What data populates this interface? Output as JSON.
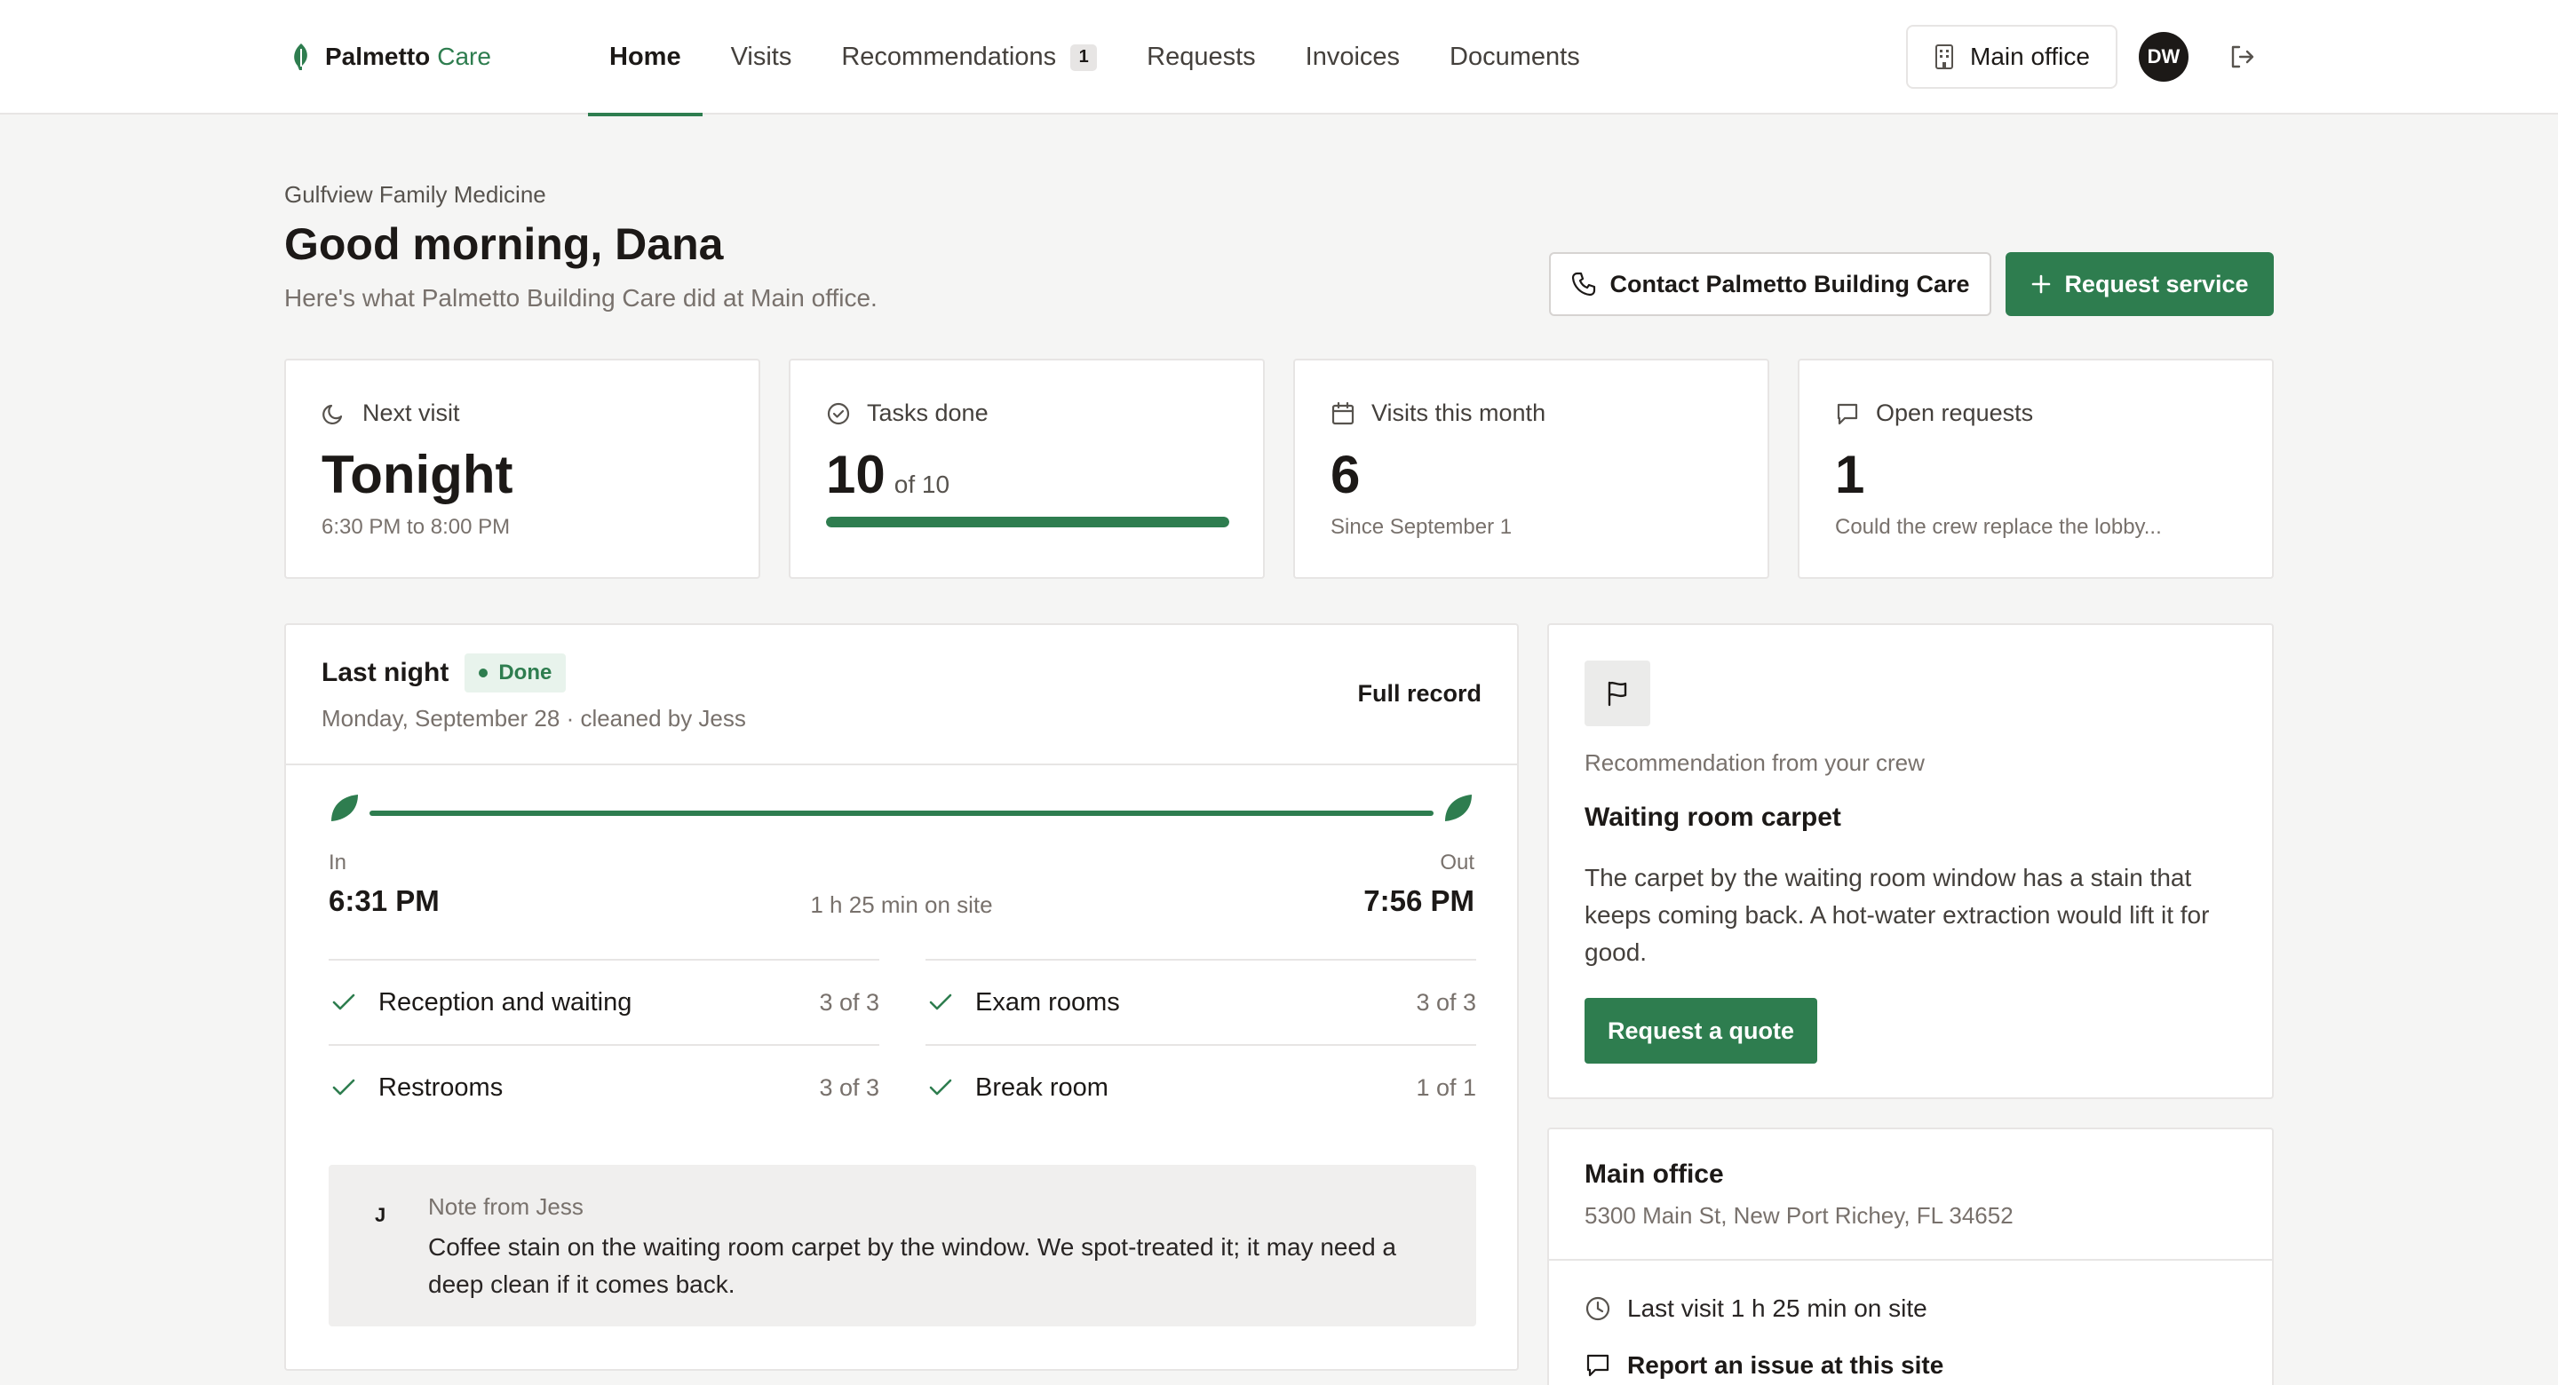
{
  "brand": {
    "name": "Palmetto",
    "suffix": "Care"
  },
  "nav": {
    "tabs": [
      {
        "label": "Home",
        "active": true
      },
      {
        "label": "Visits"
      },
      {
        "label": "Recommendations",
        "badge": "1"
      },
      {
        "label": "Requests"
      },
      {
        "label": "Invoices"
      },
      {
        "label": "Documents"
      }
    ]
  },
  "header": {
    "office_label": "Main office",
    "avatar_initials": "DW"
  },
  "page": {
    "org": "Gulfview Family Medicine",
    "greeting": "Good morning, Dana",
    "subtitle": "Here's what Palmetto Building Care did at Main office.",
    "contact_label": "Contact Palmetto Building Care",
    "request_label": "Request service"
  },
  "stats": {
    "next_visit": {
      "label": "Next visit",
      "value": "Tonight",
      "sub": "6:30 PM to 8:00 PM"
    },
    "tasks_done": {
      "label": "Tasks done",
      "value": "10",
      "of": "of 10",
      "progress": 1.0
    },
    "visits_month": {
      "label": "Visits this month",
      "value": "6",
      "sub": "Since September 1"
    },
    "open_requests": {
      "label": "Open requests",
      "value": "1",
      "sub": "Could the crew replace the lobby..."
    }
  },
  "last_visit": {
    "title": "Last night",
    "status": "Done",
    "meta": "Monday, September 28 · cleaned by Jess",
    "full_record": "Full record",
    "in_label": "In",
    "in_time": "6:31 PM",
    "duration": "1 h 25 min on site",
    "out_label": "Out",
    "out_time": "7:56 PM",
    "tasks": [
      {
        "name": "Reception and waiting",
        "count": "3 of 3"
      },
      {
        "name": "Exam rooms",
        "count": "3 of 3"
      },
      {
        "name": "Restrooms",
        "count": "3 of 3"
      },
      {
        "name": "Break room",
        "count": "1 of 1"
      }
    ],
    "note": {
      "initial": "J",
      "from": "Note from Jess",
      "text": "Coffee stain on the waiting room carpet by the window. We spot-treated it; it may need a deep clean if it comes back."
    }
  },
  "recommendation": {
    "kicker": "Recommendation from your crew",
    "title": "Waiting room carpet",
    "body": "The carpet by the waiting room window has a stain that keeps coming back. A hot-water extraction would lift it for good.",
    "button": "Request a quote"
  },
  "site": {
    "title": "Main office",
    "address": "5300 Main St, New Port Richey, FL 34652",
    "last_visit": "Last visit 1 h 25 min on site",
    "report": "Report an issue at this site"
  },
  "colors": {
    "accent": "#2e7d4f",
    "background": "#f5f5f4"
  }
}
